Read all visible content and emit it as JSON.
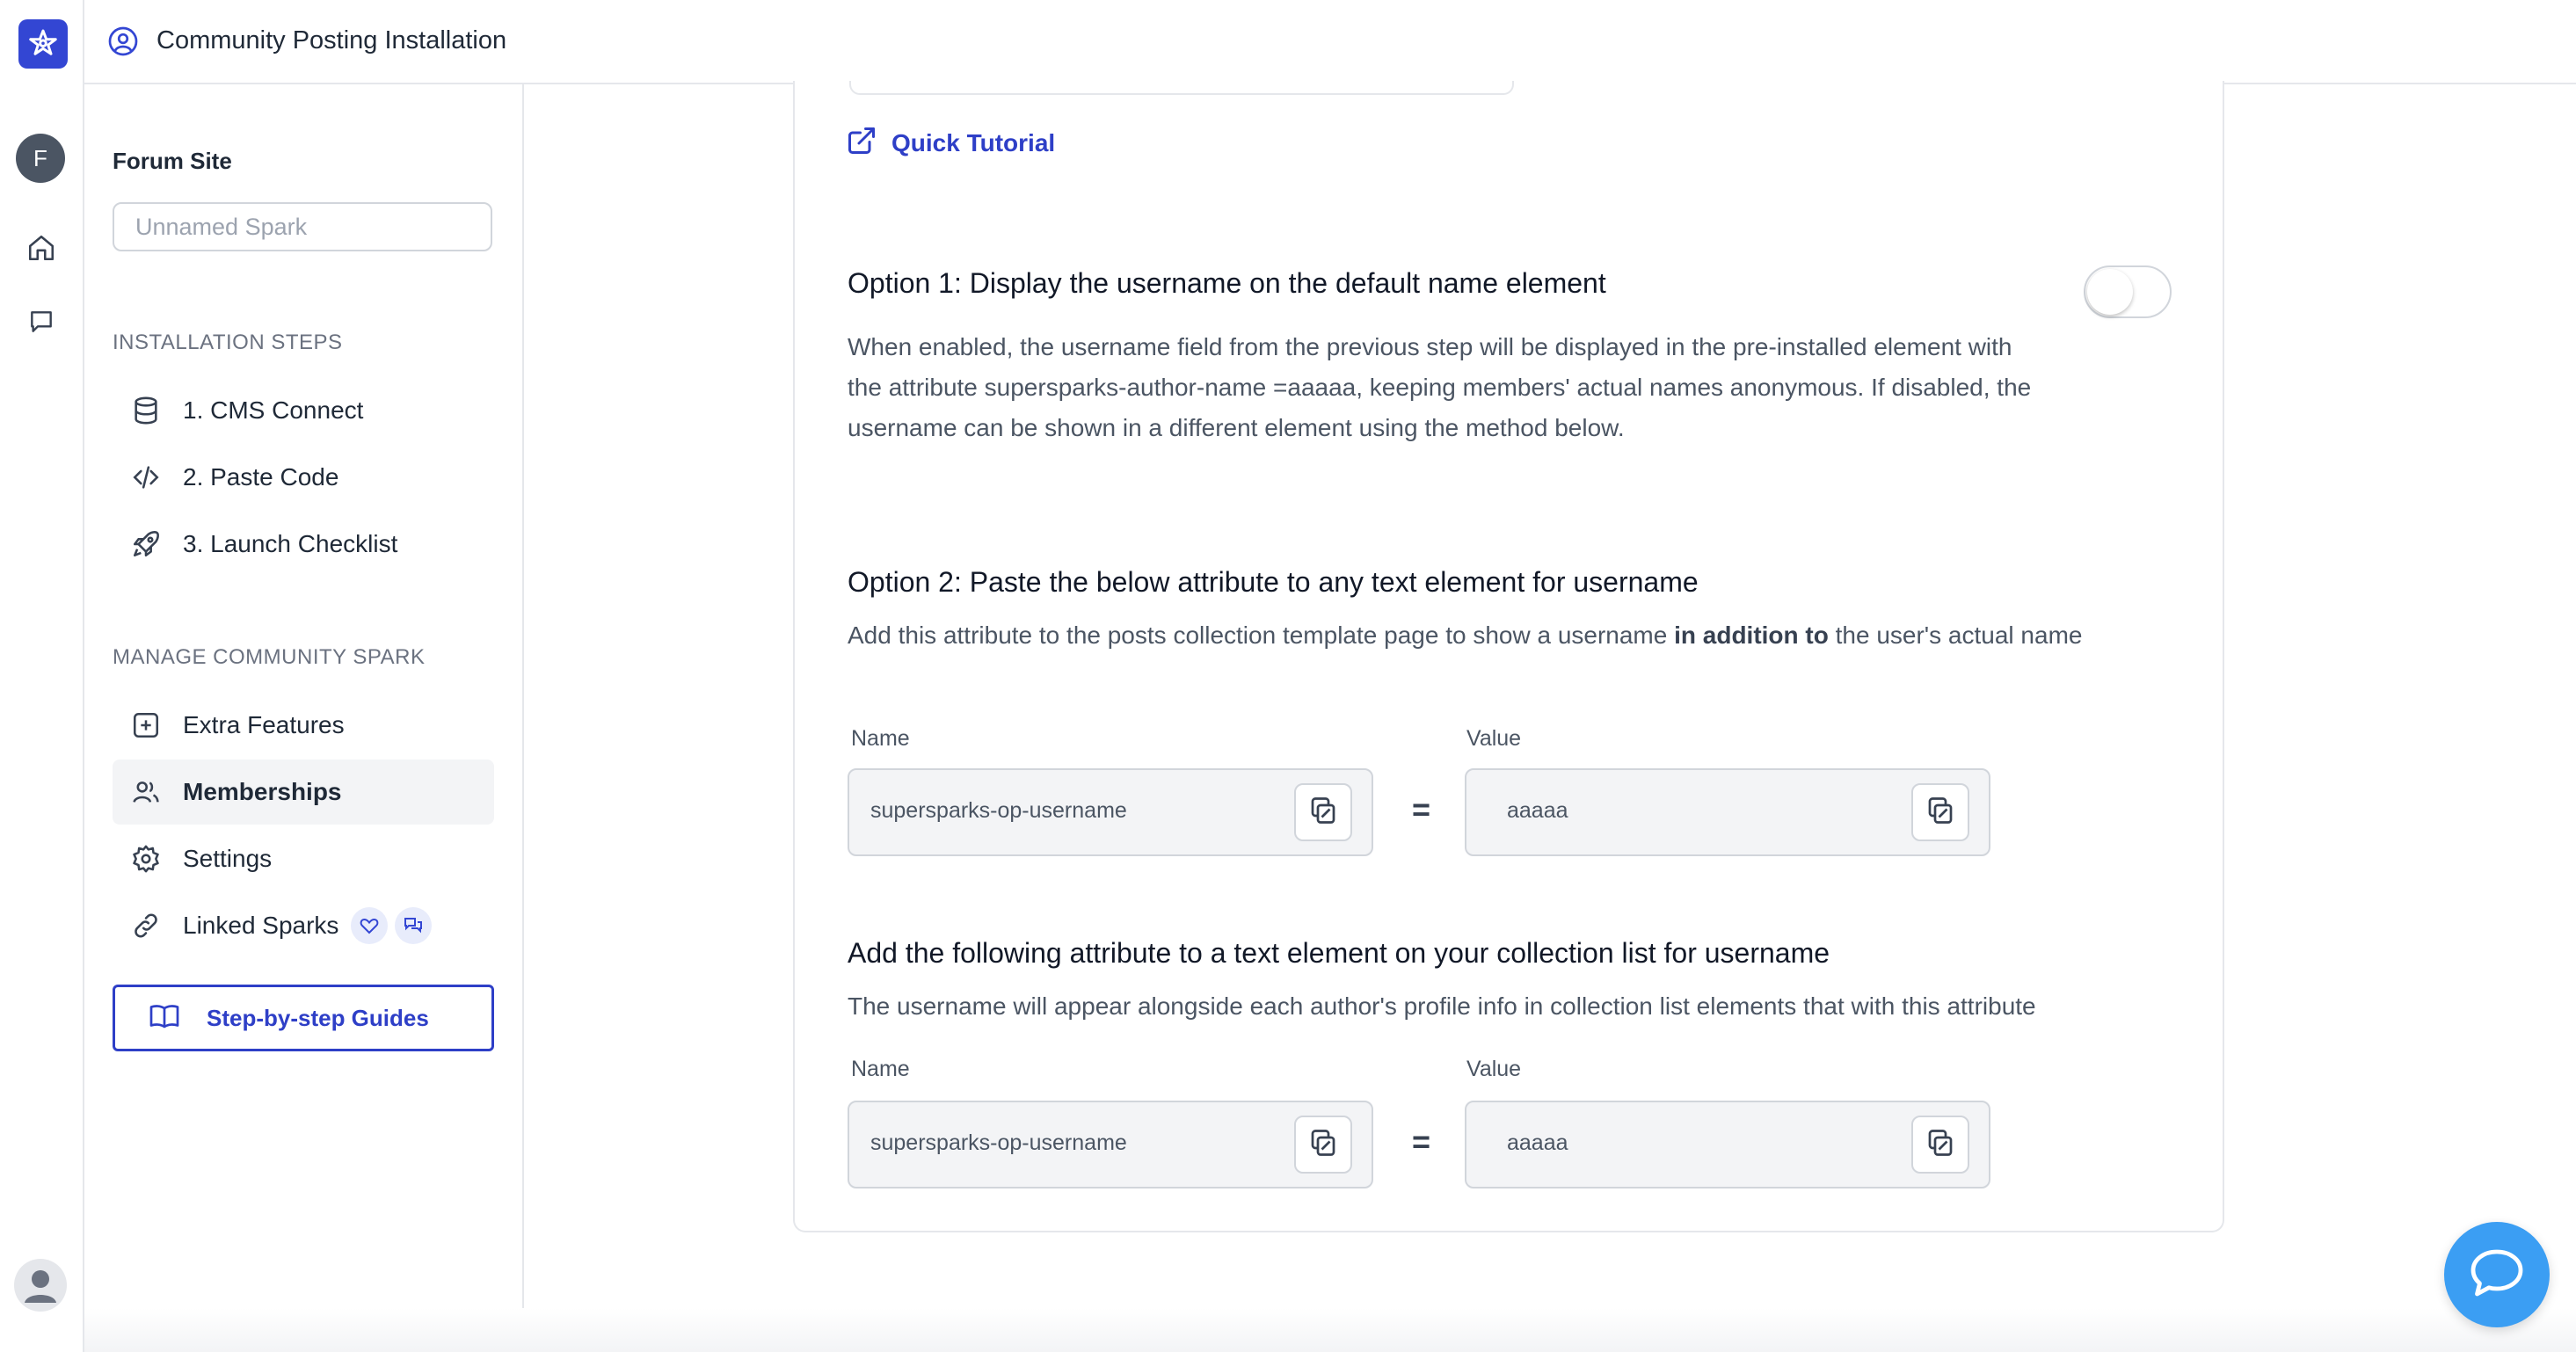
{
  "app": {
    "title": "Community Posting Installation",
    "user_initial": "F",
    "brand_color": "#3346d3",
    "accent_color": "#2e3fc7"
  },
  "rail": {
    "icons": [
      "spark-logo-icon",
      "home-icon",
      "chat-icon",
      "user-avatar-icon"
    ]
  },
  "sidebar": {
    "forum_label": "Forum Site",
    "forum_placeholder": "Unnamed Spark",
    "installation_label": "INSTALLATION STEPS",
    "installation_items": [
      {
        "label": "1. CMS Connect",
        "icon": "database-icon"
      },
      {
        "label": "2. Paste Code",
        "icon": "code-icon"
      },
      {
        "label": "3. Launch Checklist",
        "icon": "rocket-icon"
      }
    ],
    "manage_label": "MANAGE COMMUNITY SPARK",
    "manage_items": [
      {
        "label": "Extra Features",
        "icon": "plus-square-icon"
      },
      {
        "label": "Memberships",
        "icon": "users-icon",
        "active": true
      },
      {
        "label": "Settings",
        "icon": "gear-icon"
      },
      {
        "label": "Linked Sparks",
        "icon": "link-icon"
      }
    ],
    "guides_label": "Step-by-step Guides"
  },
  "main": {
    "quick_tutorial": "Quick Tutorial",
    "option1": {
      "title": "Option 1: Display the username on the default name element",
      "description": "When enabled, the username field from the previous step will be displayed in the pre-installed element with the attribute supersparks-author-name =aaaaa, keeping members' actual names anonymous. If disabled, the username can be shown in a different element using the method below.",
      "toggle_on": false
    },
    "option2": {
      "title": "Option 2: Paste the below attribute to any text element for username",
      "desc_before": "Add this attribute to the posts collection template page to show a username ",
      "desc_bold": "in addition to",
      "desc_after": " the user's actual name",
      "name_label": "Name",
      "value_label": "Value",
      "name_value": "supersparks-op-username",
      "value_value": "aaaaa",
      "equals": "="
    },
    "option3": {
      "title": "Add the following attribute to a text element on your collection list for username",
      "description": "The username will appear alongside each author's profile info in collection list elements that with this attribute",
      "name_label": "Name",
      "value_label": "Value",
      "name_value": "supersparks-op-username",
      "value_value": "aaaaa",
      "equals": "="
    }
  },
  "chat_widget_color": "#3b9ef3"
}
